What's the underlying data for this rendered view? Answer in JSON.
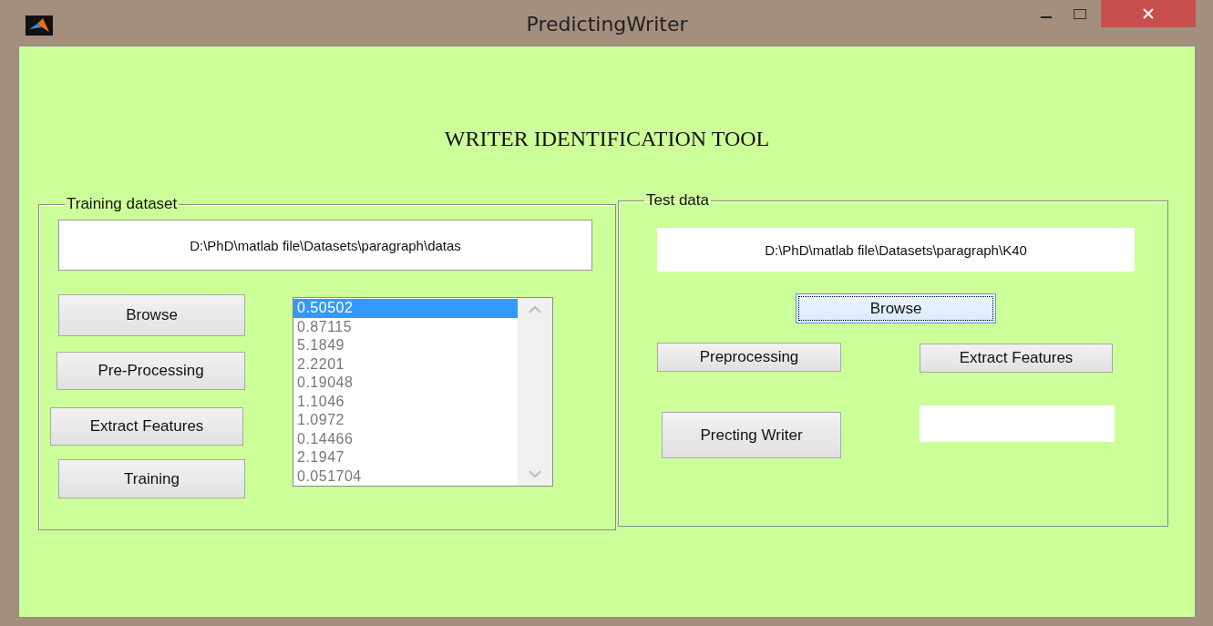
{
  "window": {
    "title": "PredictingWriter"
  },
  "heading": "WRITER IDENTIFICATION TOOL",
  "training": {
    "title": "Training dataset",
    "path": "D:\\PhD\\matlab  file\\Datasets\\paragraph\\datas",
    "buttons": [
      {
        "label": "Browse",
        "focused": false
      },
      {
        "label": "Pre-Processing",
        "focused": false
      },
      {
        "label": "Extract Features",
        "focused": false
      },
      {
        "label": "Training",
        "focused": false
      }
    ],
    "list": [
      {
        "text": "0.50502",
        "selected": true
      },
      {
        "text": "0.87115",
        "selected": false
      },
      {
        "text": "5.1849",
        "selected": false
      },
      {
        "text": "2.2201",
        "selected": false
      },
      {
        "text": "0.19048",
        "selected": false
      },
      {
        "text": "1.1046",
        "selected": false
      },
      {
        "text": "1.0972",
        "selected": false
      },
      {
        "text": "0.14466",
        "selected": false
      },
      {
        "text": "2.1947",
        "selected": false
      },
      {
        "text": "0.051704",
        "selected": false
      }
    ]
  },
  "test": {
    "title": "Test data",
    "path": "D:\\PhD\\matlab  file\\Datasets\\paragraph\\K40",
    "buttons": [
      {
        "label": "Browse",
        "focused": true
      },
      {
        "label": "Preprocessing",
        "focused": false
      },
      {
        "label": "Extract Features",
        "focused": false
      },
      {
        "label": "Precting Writer",
        "focused": false
      }
    ]
  }
}
